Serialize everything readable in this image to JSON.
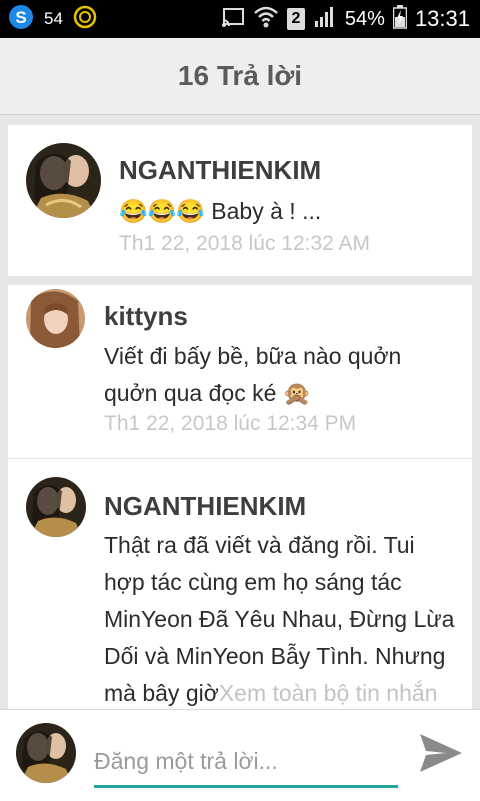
{
  "status_bar": {
    "notification_count": "54",
    "battery_percent": "54%",
    "sim_label": "2",
    "time": "13:31"
  },
  "header": {
    "title": "16 Trả lời"
  },
  "comments": [
    {
      "author": "NGANTHIENKIM",
      "message": "😂😂😂 Baby à ! ...",
      "timestamp": "Th1 22, 2018 lúc 12:32 AM"
    },
    {
      "author": "kittyns",
      "message_line1": "Viết đi bấy bề, bữa nào quởn",
      "message_line2": "quởn qua đọc ké 🙊",
      "timestamp": "Th1 22, 2018 lúc 12:34 PM"
    },
    {
      "author": "NGANTHIENKIM",
      "message_lines": [
        "Thật ra đã viết và đăng rồi. Tui",
        "hợp tác cùng em họ sáng tác",
        "MinYeon Đã Yêu Nhau, Đừng Lừa",
        "Dối và MinYeon Bẫy Tình. Nhưng"
      ],
      "message_last": "mà bây giờ",
      "see_more": "Xem toàn bộ tin nhắn"
    }
  ],
  "reply": {
    "placeholder": "Đăng một trả lời..."
  },
  "colors": {
    "accent": "#26a69a",
    "timestamp": "#c7c7c7",
    "title": "#5b5b5b"
  },
  "icons": {
    "status_app": "s-app-icon",
    "status_circle": "circle-app-icon",
    "cast": "cast-icon",
    "wifi": "wifi-icon",
    "signal": "signal-icon",
    "battery": "battery-icon",
    "send": "send-icon"
  }
}
